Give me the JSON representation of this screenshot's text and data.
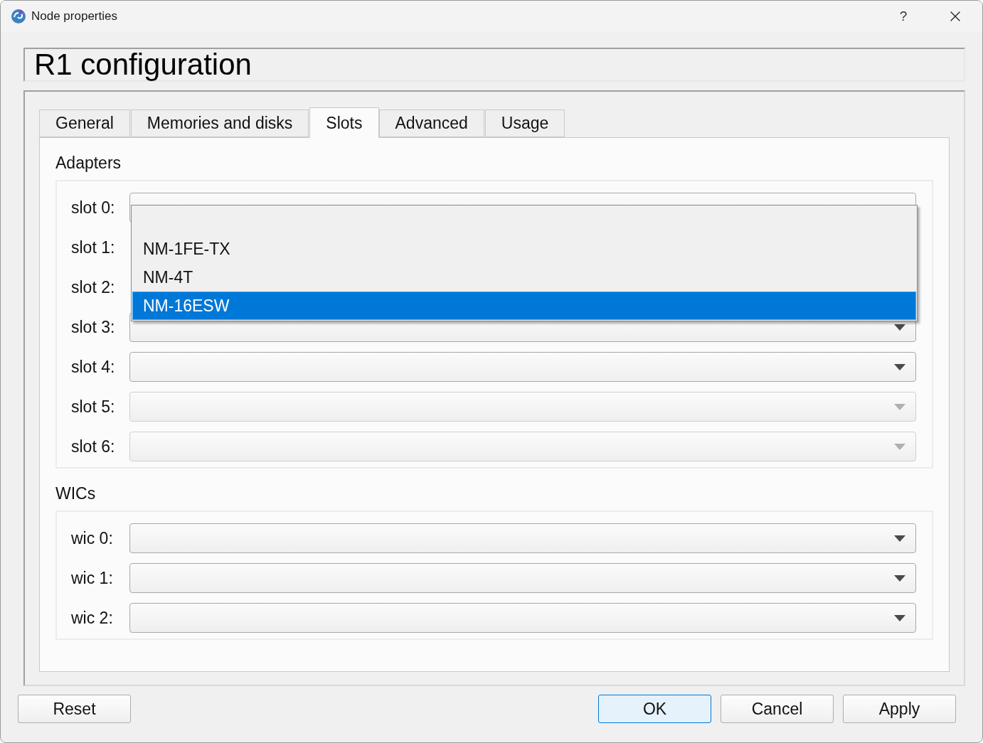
{
  "window": {
    "title": "Node properties",
    "help": "?"
  },
  "header": "R1 configuration",
  "tabs": [
    {
      "label": "General",
      "selected": false
    },
    {
      "label": "Memories and disks",
      "selected": false
    },
    {
      "label": "Slots",
      "selected": true
    },
    {
      "label": "Advanced",
      "selected": false
    },
    {
      "label": "Usage",
      "selected": false
    }
  ],
  "adapters": {
    "title": "Adapters",
    "slots": [
      {
        "label": "slot 0:",
        "kind": "open",
        "dropdown": [
          {
            "label": "NM-1FE-TX",
            "selected": false
          },
          {
            "label": "NM-4T",
            "selected": false
          },
          {
            "label": "NM-16ESW",
            "selected": true
          }
        ]
      },
      {
        "label": "slot 1:",
        "kind": "covered"
      },
      {
        "label": "slot 2:",
        "kind": "covered"
      },
      {
        "label": "slot 3:",
        "kind": "combo",
        "disabled": false
      },
      {
        "label": "slot 4:",
        "kind": "combo",
        "disabled": false
      },
      {
        "label": "slot 5:",
        "kind": "combo",
        "disabled": true
      },
      {
        "label": "slot 6:",
        "kind": "combo",
        "disabled": true
      }
    ]
  },
  "wics": {
    "title": "WICs",
    "slots": [
      {
        "label": "wic 0:",
        "kind": "combo",
        "disabled": false
      },
      {
        "label": "wic 1:",
        "kind": "combo",
        "disabled": false
      },
      {
        "label": "wic 2:",
        "kind": "combo",
        "disabled": false
      }
    ]
  },
  "buttons": {
    "left": [
      {
        "label": "Reset",
        "default": false
      }
    ],
    "right": [
      {
        "label": "OK",
        "default": true
      },
      {
        "label": "Cancel",
        "default": false
      },
      {
        "label": "Apply",
        "default": false
      }
    ]
  }
}
